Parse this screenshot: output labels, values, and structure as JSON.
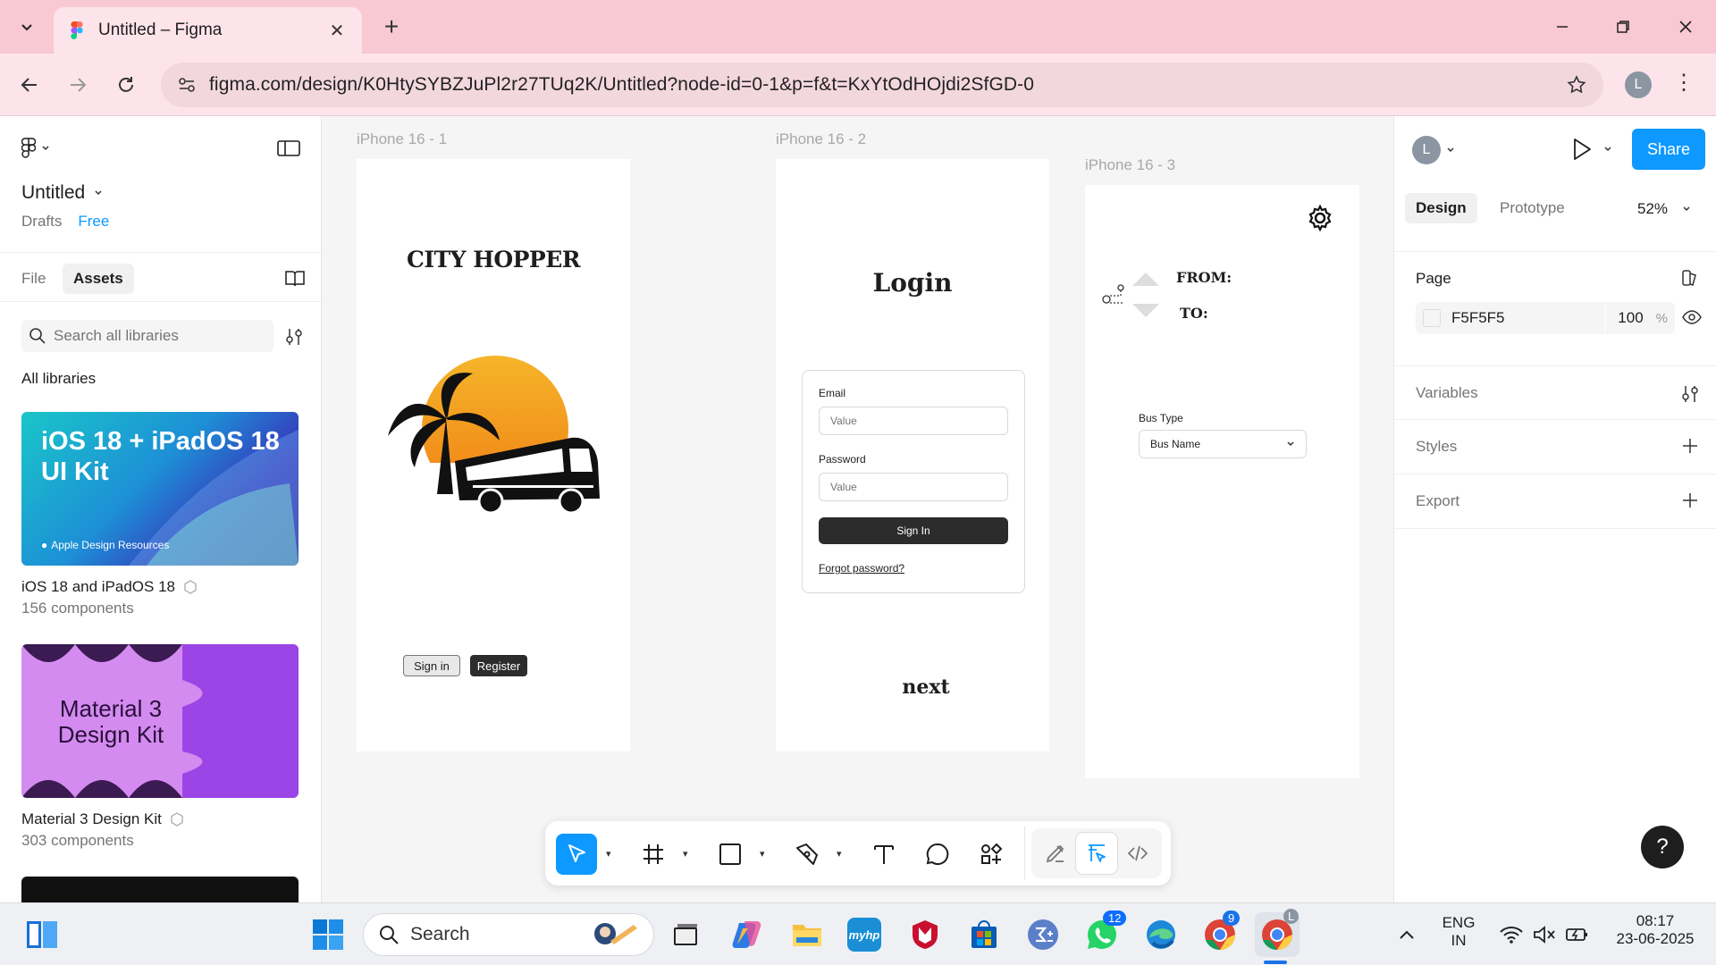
{
  "browser": {
    "tab_title": "Untitled – Figma",
    "url": "figma.com/design/K0HtySYBZJuPl2r27TUq2K/Untitled?node-id=0-1&p=f&t=KxYtOdHOjdi2SfGD-0",
    "profile_initial": "L"
  },
  "left_panel": {
    "file_name": "Untitled",
    "drafts_label": "Drafts",
    "plan_badge": "Free",
    "tabs": [
      {
        "label": "File"
      },
      {
        "label": "Assets"
      }
    ],
    "active_tab": "Assets",
    "search_placeholder": "Search all libraries",
    "section_heading": "All libraries",
    "libraries": [
      {
        "card_title": "iOS 18 + iPadOS 18 UI Kit",
        "card_footer": "Apple Design Resources",
        "name": "iOS 18 and iPadOS 18",
        "count": "156 components"
      },
      {
        "card_title": "Material 3 Design Kit",
        "name": "Material 3 Design Kit",
        "count": "303 components"
      }
    ]
  },
  "canvas": {
    "frames": [
      {
        "label": "iPhone 16 - 1",
        "heading": "CITY HOPPER",
        "buttons": {
          "sign_in": "Sign in",
          "register": "Register"
        }
      },
      {
        "label": "iPhone 16 - 2",
        "heading": "Login",
        "email_label": "Email",
        "email_placeholder": "Value",
        "password_label": "Password",
        "password_placeholder": "Value",
        "submit_label": "Sign In",
        "forgot_link": "Forgot password?",
        "next_label": "next"
      },
      {
        "label": "iPhone 16 - 3",
        "from_label": "FROM:",
        "to_label": "TO:",
        "bus_type_label": "Bus Type",
        "bus_select_value": "Bus Name"
      }
    ]
  },
  "right_panel": {
    "user_initial": "L",
    "share_label": "Share",
    "tabs": [
      {
        "label": "Design"
      },
      {
        "label": "Prototype"
      }
    ],
    "active_tab": "Design",
    "zoom": "52%",
    "page_heading": "Page",
    "page_color_hex": "F5F5F5",
    "page_opacity": "100",
    "page_opacity_unit": "%",
    "sections": [
      {
        "label": "Variables"
      },
      {
        "label": "Styles"
      },
      {
        "label": "Export"
      }
    ]
  },
  "help_label": "?",
  "taskbar": {
    "search_label": "Search",
    "whatsapp_badge": "12",
    "chrome_badge": "9",
    "chrome_profile_initial": "L",
    "myhp_label": "myhp",
    "lang_primary": "ENG",
    "lang_secondary": "IN",
    "time": "08:17",
    "date": "23-06-2025"
  },
  "colors": {
    "accent": "#0d99ff",
    "tabstrip": "#f8c8d3",
    "toolbar": "#fde4ea",
    "canvas": "#f5f5f5",
    "primary_button": "#2c2c2c"
  }
}
